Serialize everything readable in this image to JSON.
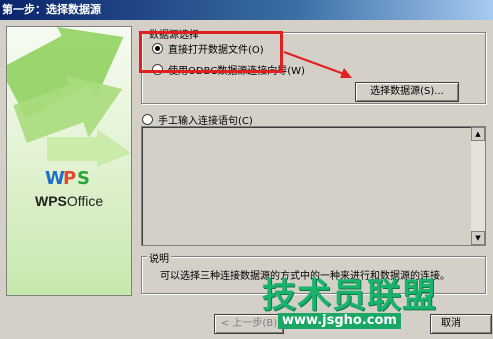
{
  "window": {
    "title": "第一步：选择数据源"
  },
  "brand": {
    "logo_text": "WPS",
    "product_bold": "WPS",
    "product_rest": "Office"
  },
  "datasource_group": {
    "legend": "数据源选择",
    "option_open_file": "直接打开数据文件(O)",
    "option_odbc": "使用ODBC数据源连接向导(W)",
    "select_button": "选择数据源(S)...",
    "selected": "option_open_file"
  },
  "manual": {
    "label": "手工输入连接语句(C)",
    "value": ""
  },
  "description": {
    "legend": "说明",
    "text": "可以选择三种连接数据源的方式中的一种来进行和数据源的连接。"
  },
  "footer": {
    "prev_button": "< 上一步(B)",
    "cancel_button": "取消"
  },
  "watermark": {
    "text": "技术员联盟",
    "url": "www.jsgho.com"
  },
  "colors": {
    "highlight": "#e02020",
    "watermark": "#19b36b",
    "title_bar": "#0a246a"
  }
}
